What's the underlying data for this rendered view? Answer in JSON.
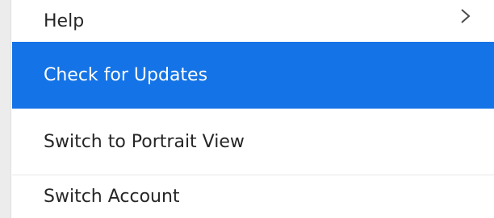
{
  "menu": {
    "items": [
      {
        "label": "Help",
        "submenu_icon": "chevron-right-icon"
      },
      {
        "label": "Check for Updates",
        "active": true
      },
      {
        "label": "Switch to Portrait View"
      },
      {
        "label": "Switch Account"
      }
    ],
    "accent_color": "#1473e6",
    "text_color": "#262626"
  }
}
